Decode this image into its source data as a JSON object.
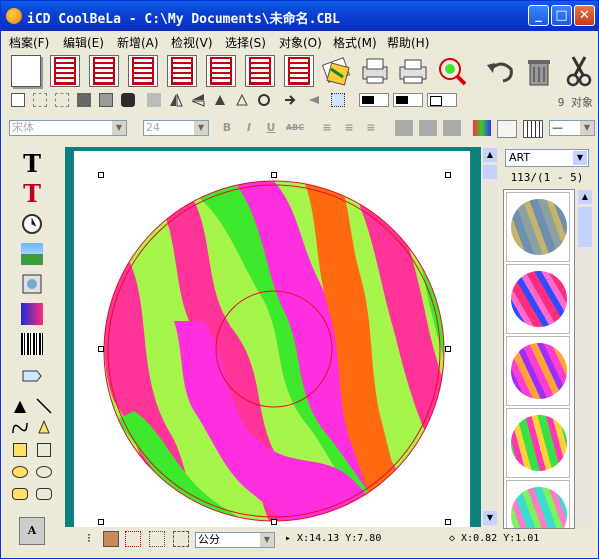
{
  "window": {
    "title": "iCD CoolBeLa - C:\\My Documents\\未命名.CBL"
  },
  "menu": [
    "档案(F)",
    "编辑(E)",
    "新增(A)",
    "检视(V)",
    "选择(S)",
    "对象(O)",
    "格式(M)",
    "帮助(H)"
  ],
  "toolbar_main": [
    "new-document",
    "format-1",
    "format-2",
    "format-3",
    "format-4",
    "format-5",
    "format-6",
    "format-7",
    "import-label",
    "print-setup",
    "print",
    "zoom-search",
    "undo",
    "trash",
    "cut"
  ],
  "toolbar_objects": {
    "count_label": "9 对象"
  },
  "format_bar": {
    "font_name": "宋体",
    "font_size": "24",
    "bold": "B",
    "italic": "I",
    "underline": "U",
    "strike": "ABC"
  },
  "design": {
    "catalog": "ART",
    "catalog_position": "113/(1 - 5)"
  },
  "status": {
    "unit": "公分",
    "cursor_pos": "X:14.13 Y:7.80",
    "zoom_info": "X:0.82 Y:1.01"
  },
  "colors": {
    "pink": "#ff3398",
    "magenta": "#ff2fe0",
    "lime": "#a6f54a",
    "green": "#3ee82c",
    "orange": "#ff6a10"
  }
}
